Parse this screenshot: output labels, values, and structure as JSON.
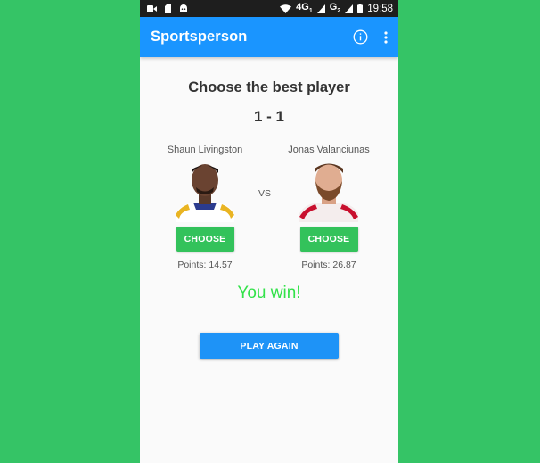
{
  "status_bar": {
    "network": "4G",
    "network_sub": "1",
    "signal2": "G",
    "signal2_sub": "2",
    "time": "19:58",
    "icons": [
      "video-icon",
      "sim-card-icon",
      "android-icon",
      "wifi-icon",
      "signal-icon",
      "battery-icon"
    ]
  },
  "app_bar": {
    "title": "Sportsperson",
    "info_icon": "info-icon",
    "menu_icon": "more-vert-icon"
  },
  "game": {
    "heading": "Choose the best player",
    "score": "1 - 1",
    "vs_label": "VS",
    "players": [
      {
        "name": "Shaun Livingston",
        "choose_label": "CHOOSE",
        "points": "Points: 14.57"
      },
      {
        "name": "Jonas Valanciunas",
        "choose_label": "CHOOSE",
        "points": "Points: 26.87"
      }
    ],
    "result": "You win!",
    "play_again_label": "PLAY AGAIN"
  },
  "colors": {
    "background": "#35c466",
    "app_bar": "#1a95ff",
    "choose_button": "#33c25b",
    "result_text": "#33e24a",
    "play_again_button": "#1e93f7"
  }
}
